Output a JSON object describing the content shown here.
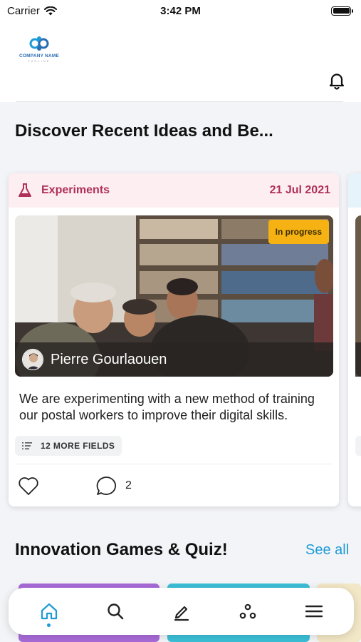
{
  "status_bar": {
    "carrier": "Carrier",
    "time": "3:42 PM"
  },
  "header": {
    "logo_text": "COMPANY NAME",
    "logo_subtext": "TAGLINE"
  },
  "sections": {
    "discover_title": "Discover Recent Ideas and Be...",
    "games_title": "Innovation Games & Quiz!",
    "games_see_all": "See all"
  },
  "idea_card": {
    "category": "Experiments",
    "date": "21 Jul 2021",
    "status_badge": "In progress",
    "author": "Pierre Gourlaouen",
    "description": "We are experimenting with a new method of training our postal workers to improve their digital skills.",
    "more_fields": "12 MORE FIELDS",
    "comment_count": "2"
  },
  "colors": {
    "accent": "#1d9bd7",
    "category_text": "#b0305a",
    "category_bg": "#fdeef1",
    "badge_bg": "#f5b212"
  },
  "nav": {
    "items": [
      {
        "icon": "home-icon",
        "active": true
      },
      {
        "icon": "search-icon",
        "active": false
      },
      {
        "icon": "edit-icon",
        "active": false
      },
      {
        "icon": "community-icon",
        "active": false
      },
      {
        "icon": "menu-icon",
        "active": false
      }
    ]
  }
}
